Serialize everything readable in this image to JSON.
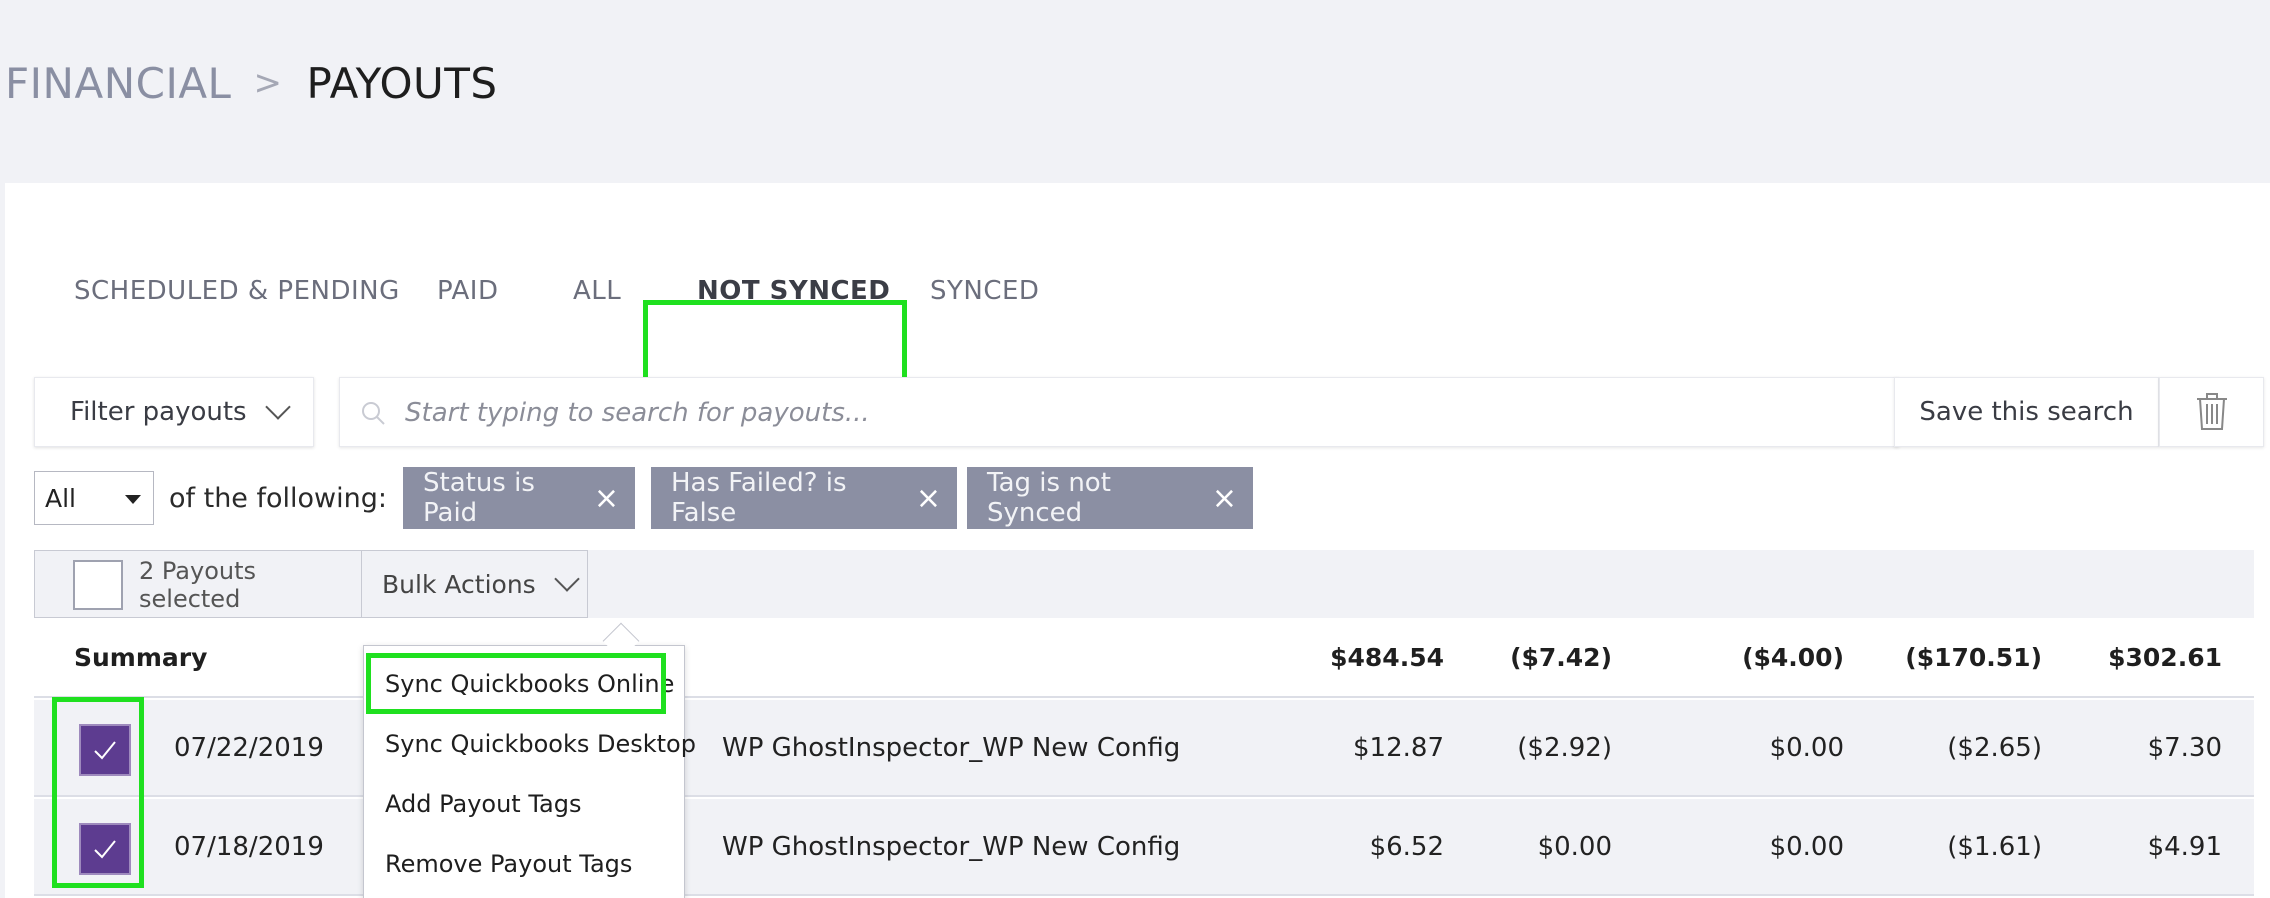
{
  "breadcrumb": {
    "parent": "FINANCIAL",
    "separator": ">",
    "current": "PAYOUTS"
  },
  "tabs": [
    {
      "label": "SCHEDULED & PENDING",
      "active": false
    },
    {
      "label": "PAID",
      "active": false
    },
    {
      "label": "ALL",
      "active": false
    },
    {
      "label": "NOT SYNCED",
      "active": true
    },
    {
      "label": "SYNCED",
      "active": false
    }
  ],
  "filter": {
    "button_label": "Filter payouts",
    "search_placeholder": "Start typing to search for payouts...",
    "save_label": "Save this search"
  },
  "criteria": {
    "match_value": "All",
    "label": "of the following:",
    "chips": [
      "Status is Paid",
      "Has Failed? is False",
      "Tag is not Synced"
    ]
  },
  "bulk": {
    "selected_text": "2 Payouts selected",
    "actions_label": "Bulk Actions",
    "menu": [
      "Sync Quickbooks Online",
      "Sync Quickbooks Desktop",
      "Add Payout Tags",
      "Remove Payout Tags"
    ]
  },
  "summary": {
    "label": "Summary",
    "values": [
      "$484.54",
      "($7.42)",
      "($4.00)",
      "($170.51)",
      "$302.61"
    ]
  },
  "rows": [
    {
      "date": "07/22/2019",
      "name": "WP GhostInspector_WP New Config",
      "values": [
        "$12.87",
        "($2.92)",
        "$0.00",
        "($2.65)",
        "$7.30"
      ],
      "checked": true
    },
    {
      "date": "07/18/2019",
      "name": "WP GhostInspector_WP New Config",
      "values": [
        "$6.52",
        "$0.00",
        "$0.00",
        "($1.61)",
        "$4.91"
      ],
      "checked": true
    }
  ],
  "colors": {
    "highlight": "#1fe01f",
    "accent_purple": "#5d3c90",
    "chip_gray": "#8b8fa3"
  },
  "icons": {
    "search": "search-icon",
    "trash": "trash-icon",
    "check": "check-icon",
    "close": "close-icon",
    "chevron": "chevron-down-icon"
  }
}
